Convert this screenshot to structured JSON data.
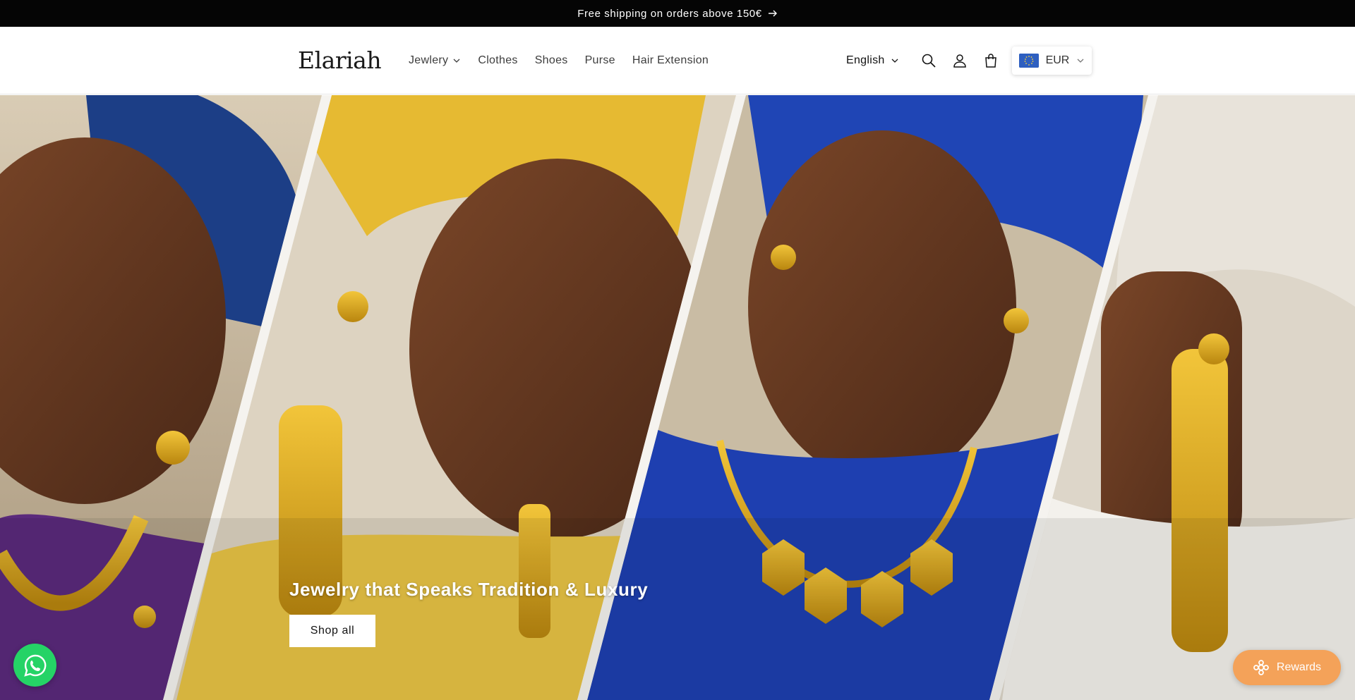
{
  "announcement": {
    "text": "Free shipping on orders above 150€",
    "arrow_icon": "arrow-right-icon"
  },
  "header": {
    "logo": "Elariah",
    "nav": [
      {
        "label": "Jewlery",
        "has_dropdown": true
      },
      {
        "label": "Clothes",
        "has_dropdown": false
      },
      {
        "label": "Shoes",
        "has_dropdown": false
      },
      {
        "label": "Purse",
        "has_dropdown": false
      },
      {
        "label": "Hair Extension",
        "has_dropdown": false
      }
    ],
    "language": "English",
    "icons": [
      "search-icon",
      "account-icon",
      "cart-icon"
    ],
    "currency": {
      "code": "EUR",
      "flag": "eu-flag-icon"
    }
  },
  "hero": {
    "title": "Jewelry that Speaks Tradition & Luxury",
    "button_label": "Shop all",
    "colors": {
      "gold": "#d9a520",
      "royal_blue": "#1f45b5",
      "yellow": "#e9bf35",
      "skin": "#6b3c22"
    }
  },
  "widgets": {
    "whatsapp_icon": "whatsapp-icon",
    "rewards_label": "Rewards",
    "rewards_icon": "gift-icon",
    "colors": {
      "whatsapp": "#25d366",
      "rewards": "#f4a259"
    }
  }
}
